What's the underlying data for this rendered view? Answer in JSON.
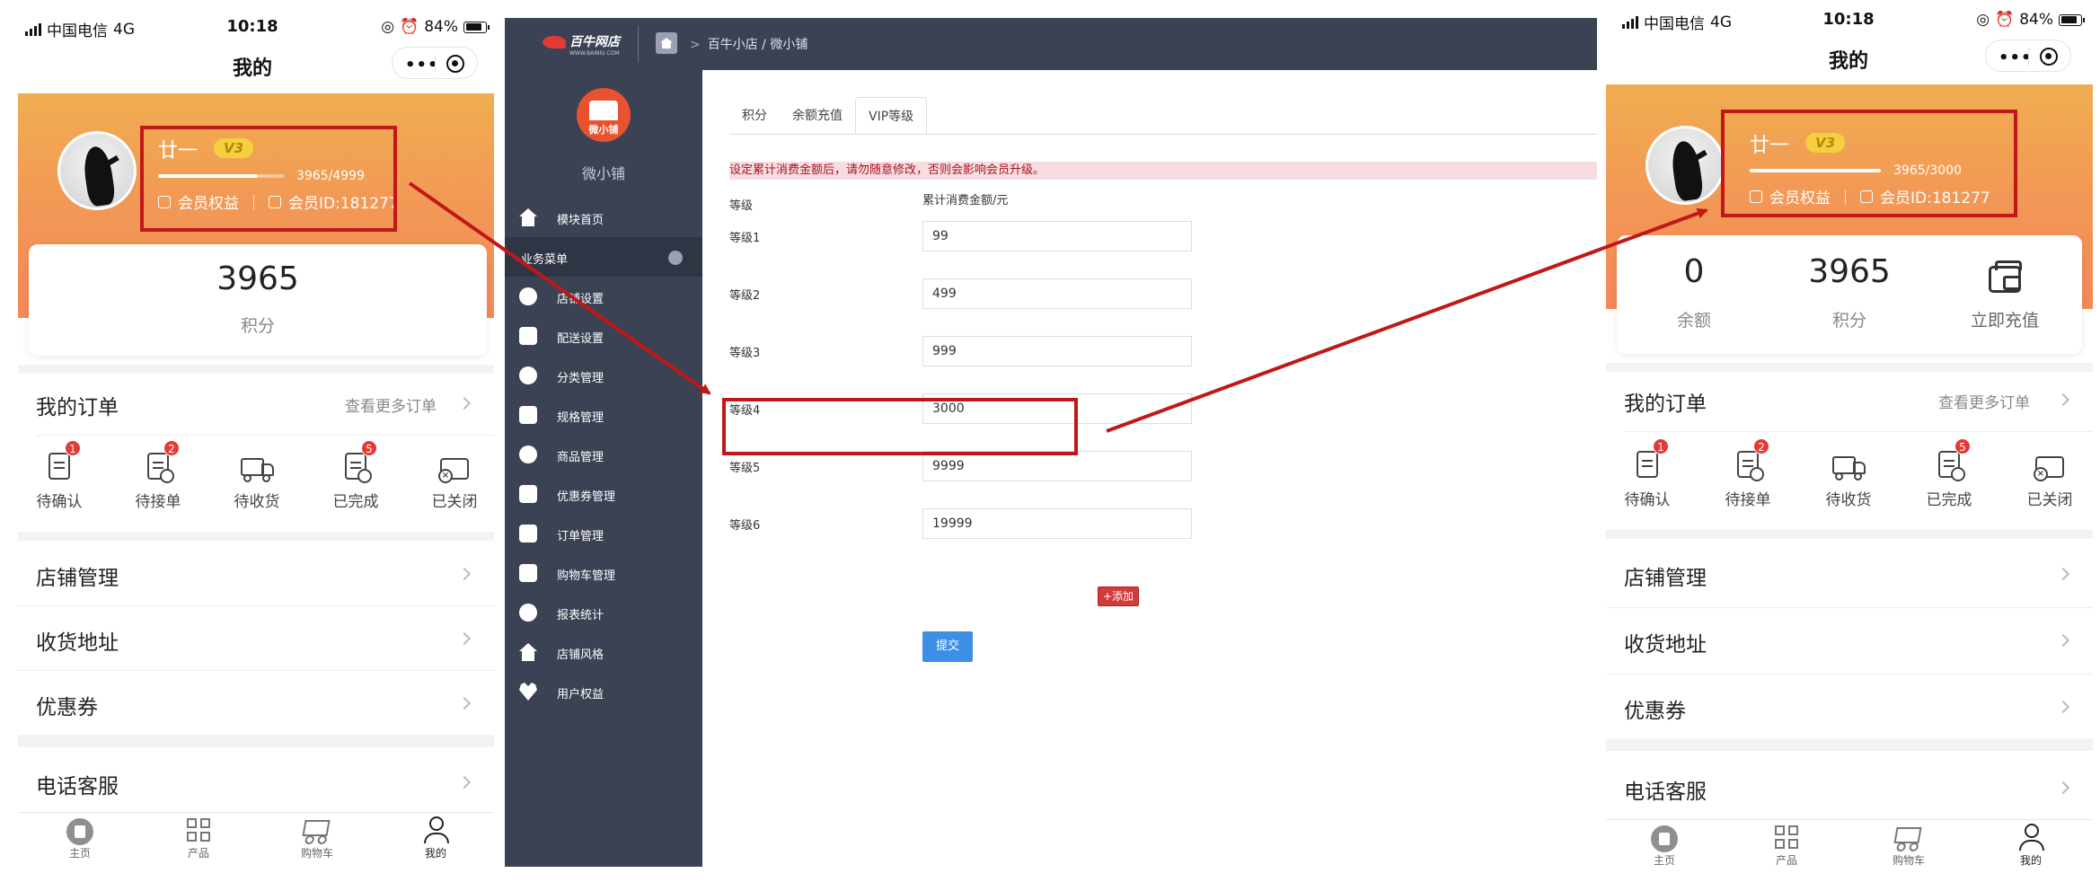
{
  "status": {
    "carrier": "中国电信",
    "network": "4G",
    "time": "10:18",
    "battery": "84%"
  },
  "phone": {
    "nav_title": "我的",
    "user": {
      "name": "廿一",
      "level_badge": "V3",
      "rights": "会员权益",
      "member_id": "会员ID:181277"
    },
    "left_progress": {
      "text": "3965/4999",
      "fraction": 0.79
    },
    "right_progress": {
      "text": "3965/3000",
      "fraction": 1.0
    },
    "left_card": {
      "points_value": "3965",
      "points_label": "积分"
    },
    "right_card": {
      "balance_value": "0",
      "balance_label": "余额",
      "points_value": "3965",
      "points_label": "积分",
      "recharge_label": "立即充值"
    },
    "orders": {
      "title": "我的订单",
      "more": "查看更多订单",
      "items": [
        {
          "label": "待确认",
          "badge": "1"
        },
        {
          "label": "待接单",
          "badge": "2"
        },
        {
          "label": "待收货",
          "badge": ""
        },
        {
          "label": "已完成",
          "badge": "5"
        },
        {
          "label": "已关闭",
          "badge": ""
        }
      ]
    },
    "menu": [
      "店铺管理",
      "收货地址",
      "优惠券",
      "电话客服"
    ],
    "tabbar": [
      "主页",
      "产品",
      "购物车",
      "我的"
    ]
  },
  "admin": {
    "logo": "百牛网店",
    "logo_sub": "WWW.BAINIU.COM",
    "breadcrumb": "百牛小店 / 微小铺",
    "shop_name": "微小铺",
    "sidebar": [
      {
        "label": "模块首页",
        "type": "item"
      },
      {
        "label": "业务菜单",
        "type": "group"
      },
      {
        "label": "店铺设置",
        "type": "item"
      },
      {
        "label": "配送设置",
        "type": "item"
      },
      {
        "label": "分类管理",
        "type": "item"
      },
      {
        "label": "规格管理",
        "type": "item"
      },
      {
        "label": "商品管理",
        "type": "item"
      },
      {
        "label": "优惠券管理",
        "type": "item"
      },
      {
        "label": "订单管理",
        "type": "item"
      },
      {
        "label": "购物车管理",
        "type": "item"
      },
      {
        "label": "报表统计",
        "type": "item"
      },
      {
        "label": "店铺风格",
        "type": "item"
      },
      {
        "label": "用户权益",
        "type": "item"
      }
    ],
    "tabs": [
      "积分",
      "余额充值",
      "VIP等级"
    ],
    "active_tab": "VIP等级",
    "warning": "设定累计消费金额后，请勿随意修改，否则会影响会员升级。",
    "col_level": "等级",
    "col_amount": "累计消费金额/元",
    "levels": [
      {
        "label": "等级1",
        "value": "99"
      },
      {
        "label": "等级2",
        "value": "499"
      },
      {
        "label": "等级3",
        "value": "999"
      },
      {
        "label": "等级4",
        "value": "3000"
      },
      {
        "label": "等级5",
        "value": "9999"
      },
      {
        "label": "等级6",
        "value": "19999"
      }
    ],
    "add_button": "+添加",
    "submit_button": "提交"
  },
  "colors": {
    "annotation_red": "#c01818",
    "hero_orange": "#f29a55",
    "sidebar": "#3b4254",
    "primary_blue": "#3d8fe6"
  }
}
